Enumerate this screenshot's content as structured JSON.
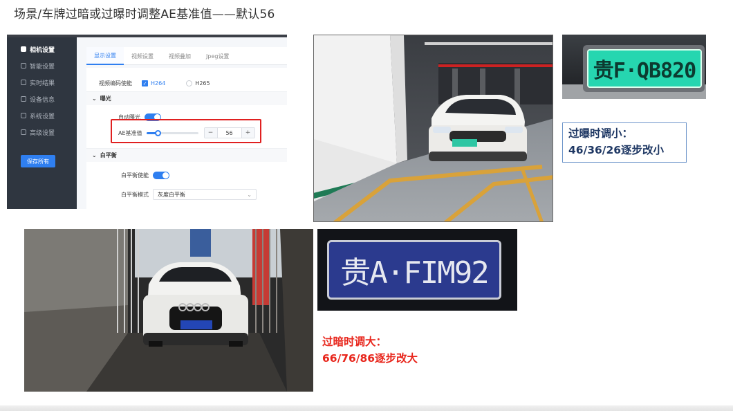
{
  "slide": {
    "title": "场景/车牌过暗或过曝时调整AE基准值——默认56"
  },
  "settings_ui": {
    "sidebar": [
      {
        "label": "相机设置",
        "icon": "camera-icon",
        "active": true
      },
      {
        "label": "智能设置",
        "icon": "grid-icon",
        "active": false
      },
      {
        "label": "实时结果",
        "icon": "list-icon",
        "active": false
      },
      {
        "label": "设备信息",
        "icon": "info-icon",
        "active": false
      },
      {
        "label": "系统设置",
        "icon": "gear-icon",
        "active": false
      },
      {
        "label": "高级设置",
        "icon": "settings-icon",
        "active": false
      }
    ],
    "save_label": "保存所有",
    "tabs": [
      "显示设置",
      "视频设置",
      "视频叠加",
      "Jpeg设置"
    ],
    "encode_label": "视频编码使能",
    "encode_h264": "H264",
    "encode_h265": "H265",
    "exposure_section": "曝光",
    "auto_exposure_label": "自动曝光",
    "ae_label": "AE基准值",
    "ae_value": "56",
    "ae_level": 0.22,
    "minus": "−",
    "plus": "+",
    "wb_section": "白平衡",
    "wb_enable_label": "白平衡使能",
    "wb_mode_label": "白平衡模式",
    "wb_mode_value": "灰度白平衡"
  },
  "plates": {
    "bright": "贵F·QB820",
    "dark": "贵A·FIM92"
  },
  "callouts": {
    "overexposed_line1": "过曝时调小：",
    "overexposed_line2": "46/36/26逐步改小",
    "underexposed_line1": "过暗时调大：",
    "underexposed_line2": "66/76/86逐步改大"
  },
  "colors": {
    "accent": "#2f7ff0",
    "highlight_red": "#e02020",
    "callout_red": "#e8261c",
    "callout_blue": "#1f3864"
  }
}
